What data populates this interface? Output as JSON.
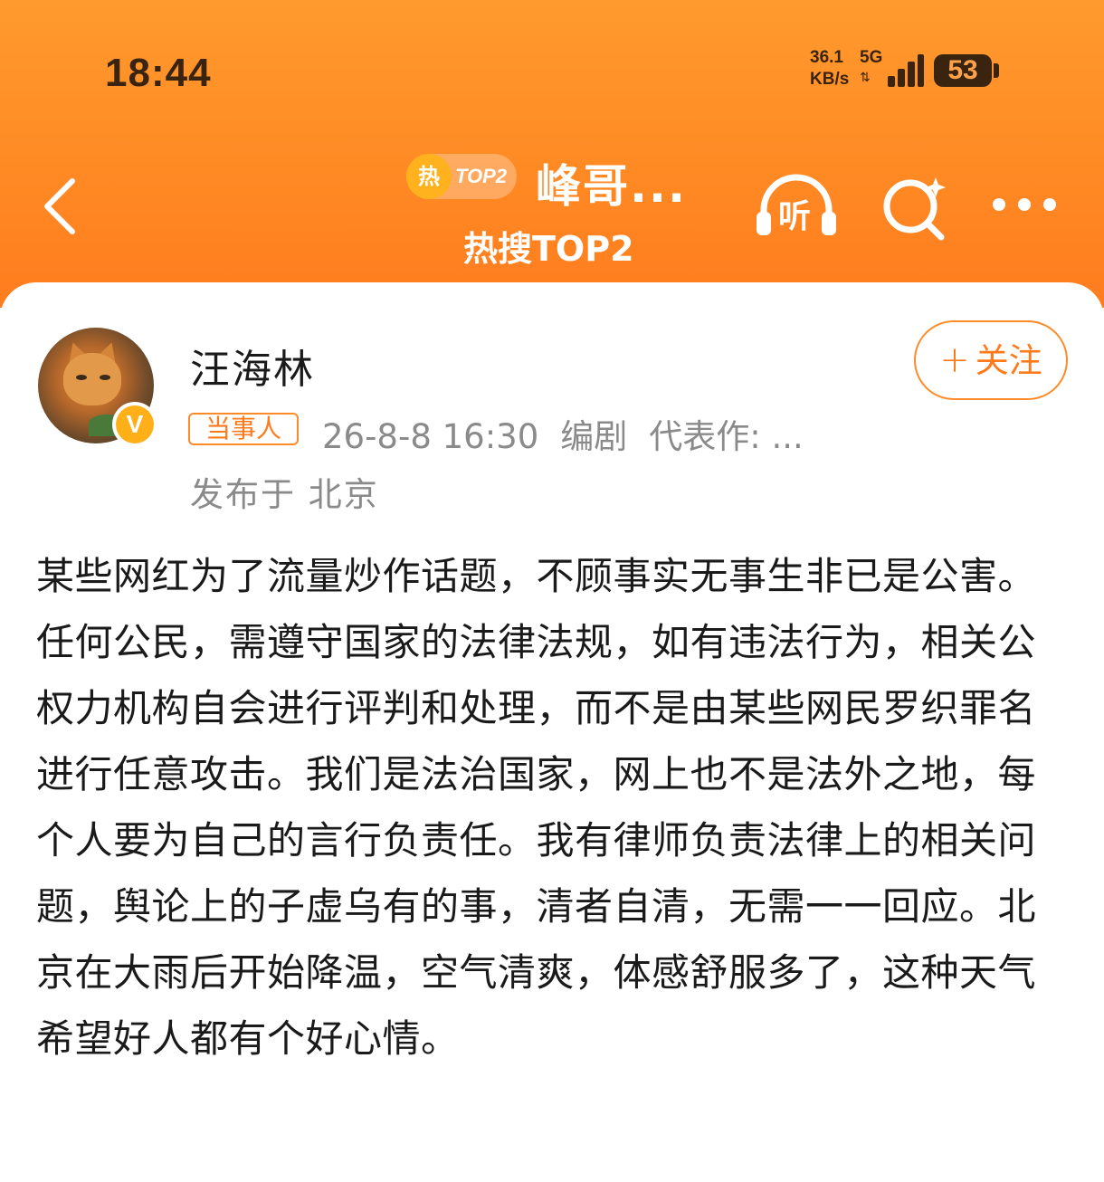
{
  "status_bar": {
    "time": "18:44",
    "net_speed_value": "36.1",
    "net_speed_unit": "KB/s",
    "network_type": "5G",
    "battery": "53"
  },
  "nav": {
    "hot_badge_icon": "热",
    "hot_badge_rank": "TOP2",
    "title": "峰哥...",
    "subtitle": "热搜TOP2",
    "listen_label": "听"
  },
  "post": {
    "author": "汪海林",
    "role_badge": "当事人",
    "time": "26-8-8 16:30",
    "profession": "编剧",
    "works": "代表作: ...",
    "location": "发布于 北京",
    "follow_label": "关注",
    "content": "某些网红为了流量炒作话题，不顾事实无事生非已是公害。任何公民，需遵守国家的法律法规，如有违法行为，相关公权力机构自会进行评判和处理，而不是由某些网民罗织罪名进行任意攻击。我们是法治国家，网上也不是法外之地，每个人要为自己的言行负责任。我有律师负责法律上的相关问题，舆论上的子虚乌有的事，清者自清，无需一一回应。北京在大雨后开始降温，空气清爽，体感舒服多了，这种天气希望好人都有个好心情。"
  },
  "colors": {
    "header_orange": "#ff8a24",
    "accent_orange": "#ff7a1a",
    "text_primary": "#1a1a1a",
    "text_secondary": "#8a8a8a",
    "verified_yellow": "#ffb019"
  }
}
